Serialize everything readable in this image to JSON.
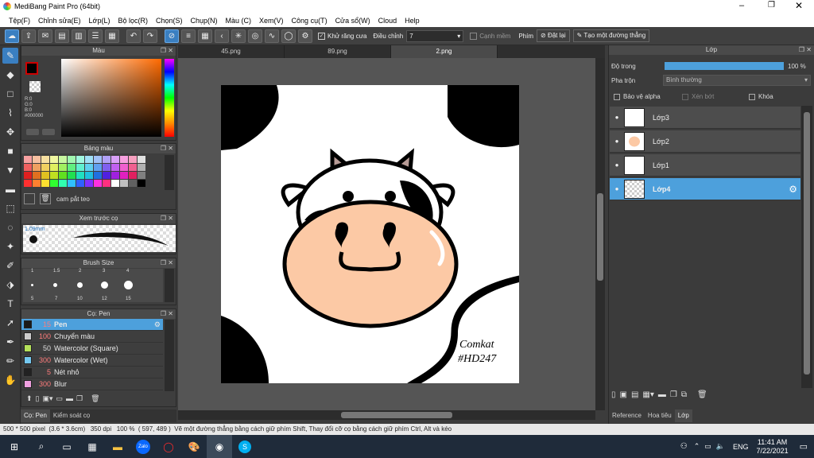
{
  "window": {
    "title": "MediBang Paint Pro (64bit)"
  },
  "menu": [
    "Tệp(F)",
    "Chỉnh sửa(E)",
    "Lớp(L)",
    "Bộ lọc(R)",
    "Chọn(S)",
    "Chụp(N)",
    "Màu (C)",
    "Xem(V)",
    "Công cụ(T)",
    "Cửa sổ(W)",
    "Cloud",
    "Help"
  ],
  "toolbar": {
    "antialias_label": "Khử răng cưa",
    "adjust_label": "Điều chỉnh",
    "adjust_value": "7",
    "edge_label": "Cạnh mềm",
    "key_label": "Phím",
    "reset_label": "Đặt lại",
    "line_label": "Tạo một đường thẳng"
  },
  "color_panel": {
    "title": "Màu",
    "rgb": [
      "R:0",
      "G:0",
      "B:0"
    ],
    "hex": "#000000"
  },
  "palette_panel": {
    "title": "Bảng màu",
    "item": "cam pắt teo"
  },
  "preview_panel": {
    "title": "Xem trước cọ",
    "size": "1.09mm"
  },
  "brushsize_panel": {
    "title": "Brush Size",
    "sizes_top": [
      "1",
      "1.5",
      "2",
      "3",
      "4"
    ],
    "sizes_bottom": [
      "5",
      "7",
      "10",
      "12",
      "15"
    ]
  },
  "brush_panel": {
    "title": "Cọ: Pen",
    "items": [
      {
        "num": "15",
        "name": "Pen",
        "color": "#1a1a1a"
      },
      {
        "num": "100",
        "name": "Chuyển màu",
        "color": "#cccccc"
      },
      {
        "num": "50",
        "name": "Watercolor (Square)",
        "color": "#b4e05a"
      },
      {
        "num": "300",
        "name": "Watercolor (Wet)",
        "color": "#74c8f0"
      },
      {
        "num": "5",
        "name": "Nét nhỏ",
        "color": "#222222"
      },
      {
        "num": "300",
        "name": "Blur",
        "color": "#f0a0e0"
      }
    ]
  },
  "bottom_tabs": [
    "Cọ: Pen",
    "Kiểm soát cọ"
  ],
  "doc_tabs": [
    "45.png",
    "89.png",
    "2.png"
  ],
  "signature": {
    "line1": "Comkat",
    "line2": "#HD247"
  },
  "layer_panel": {
    "title": "Lớp",
    "opacity_label": "Độ trong",
    "opacity_value": "100 %",
    "opacity_fraction": 1.0,
    "blend_label": "Pha trộn",
    "blend_value": "Bình thường",
    "protect_alpha": "Bảo vệ alpha",
    "clipping": "Xén bớt",
    "lock": "Khóa",
    "layers": [
      "Lớp3",
      "Lớp2",
      "Lớp1",
      "Lớp4"
    ]
  },
  "right_tabs": [
    "Reference",
    "Hoa tiêu",
    "Lớp"
  ],
  "status": {
    "size": "500 * 500 pixel",
    "cm": "(3.6 * 3.6cm)",
    "dpi": "350 dpi",
    "zoom": "100 %",
    "coords": "( 597, 489 )",
    "hint": "Vẽ một đường thẳng bằng cách giữ phím Shift, Thay đổi cỡ cọ bằng cách giữ phím Ctrl, Alt và kéo"
  },
  "taskbar": {
    "lang": "ENG",
    "time": "11:41 AM",
    "date": "7/22/2021"
  }
}
